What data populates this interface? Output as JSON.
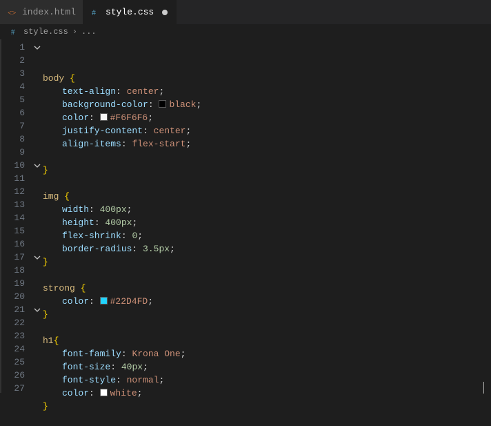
{
  "tabs": [
    {
      "label": "index.html",
      "icon_color": "#e37933",
      "active": false
    },
    {
      "label": "style.css",
      "icon_color": "#519aba",
      "active": true,
      "dirty": true
    }
  ],
  "breadcrumb": {
    "file_icon_color": "#519aba",
    "file": "style.css",
    "rest": "..."
  },
  "lines": [
    {
      "n": "1",
      "fold": true,
      "indent": 0,
      "tokens": [
        [
          "sel",
          "body"
        ],
        [
          "punc",
          " "
        ],
        [
          "brace",
          "{"
        ]
      ]
    },
    {
      "n": "2",
      "fold": false,
      "indent": 1,
      "tokens": [
        [
          "prop",
          "text-align"
        ],
        [
          "punc",
          ": "
        ],
        [
          "val",
          "center"
        ],
        [
          "punc",
          ";"
        ]
      ]
    },
    {
      "n": "3",
      "fold": false,
      "indent": 1,
      "tokens": [
        [
          "prop",
          "background-color"
        ],
        [
          "punc",
          ": "
        ],
        [
          "swatch",
          "#000000"
        ],
        [
          "val",
          "black"
        ],
        [
          "punc",
          ";"
        ]
      ]
    },
    {
      "n": "4",
      "fold": false,
      "indent": 1,
      "tokens": [
        [
          "prop",
          "color"
        ],
        [
          "punc",
          ": "
        ],
        [
          "swatch",
          "#F6F6F6"
        ],
        [
          "val",
          "#F6F6F6"
        ],
        [
          "punc",
          ";"
        ]
      ]
    },
    {
      "n": "5",
      "fold": false,
      "indent": 1,
      "tokens": [
        [
          "prop",
          "justify-content"
        ],
        [
          "punc",
          ": "
        ],
        [
          "val",
          "center"
        ],
        [
          "punc",
          ";"
        ]
      ]
    },
    {
      "n": "6",
      "fold": false,
      "indent": 1,
      "tokens": [
        [
          "prop",
          "align-items"
        ],
        [
          "punc",
          ": "
        ],
        [
          "val",
          "flex-start"
        ],
        [
          "punc",
          ";"
        ]
      ]
    },
    {
      "n": "7",
      "fold": false,
      "indent": 0,
      "tokens": []
    },
    {
      "n": "8",
      "fold": false,
      "indent": 0,
      "tokens": [
        [
          "brace",
          "}"
        ]
      ]
    },
    {
      "n": "9",
      "fold": false,
      "indent": 0,
      "tokens": []
    },
    {
      "n": "10",
      "fold": true,
      "indent": 0,
      "tokens": [
        [
          "sel",
          "img"
        ],
        [
          "punc",
          " "
        ],
        [
          "brace",
          "{"
        ]
      ]
    },
    {
      "n": "11",
      "fold": false,
      "indent": 1,
      "tokens": [
        [
          "prop",
          "width"
        ],
        [
          "punc",
          ": "
        ],
        [
          "num",
          "400"
        ],
        [
          "unit",
          "px"
        ],
        [
          "punc",
          ";"
        ]
      ]
    },
    {
      "n": "12",
      "fold": false,
      "indent": 1,
      "tokens": [
        [
          "prop",
          "height"
        ],
        [
          "punc",
          ": "
        ],
        [
          "num",
          "400"
        ],
        [
          "unit",
          "px"
        ],
        [
          "punc",
          ";"
        ]
      ]
    },
    {
      "n": "13",
      "fold": false,
      "indent": 1,
      "tokens": [
        [
          "prop",
          "flex-shrink"
        ],
        [
          "punc",
          ": "
        ],
        [
          "num",
          "0"
        ],
        [
          "punc",
          ";"
        ]
      ]
    },
    {
      "n": "14",
      "fold": false,
      "indent": 1,
      "tokens": [
        [
          "prop",
          "border-radius"
        ],
        [
          "punc",
          ": "
        ],
        [
          "num",
          "3.5"
        ],
        [
          "unit",
          "px"
        ],
        [
          "punc",
          ";"
        ]
      ]
    },
    {
      "n": "15",
      "fold": false,
      "indent": 0,
      "tokens": [
        [
          "brace",
          "}"
        ]
      ]
    },
    {
      "n": "16",
      "fold": false,
      "indent": 0,
      "tokens": []
    },
    {
      "n": "17",
      "fold": true,
      "indent": 0,
      "tokens": [
        [
          "sel",
          "strong"
        ],
        [
          "punc",
          " "
        ],
        [
          "brace",
          "{"
        ]
      ]
    },
    {
      "n": "18",
      "fold": false,
      "indent": 1,
      "tokens": [
        [
          "prop",
          "color"
        ],
        [
          "punc",
          ": "
        ],
        [
          "swatch",
          "#22D4FD"
        ],
        [
          "val",
          "#22D4FD"
        ],
        [
          "punc",
          ";"
        ]
      ]
    },
    {
      "n": "19",
      "fold": false,
      "indent": 0,
      "tokens": [
        [
          "brace",
          "}"
        ]
      ]
    },
    {
      "n": "20",
      "fold": false,
      "indent": 0,
      "tokens": []
    },
    {
      "n": "21",
      "fold": true,
      "indent": 0,
      "tokens": [
        [
          "sel",
          "h1"
        ],
        [
          "brace",
          "{"
        ]
      ]
    },
    {
      "n": "22",
      "fold": false,
      "indent": 1,
      "tokens": [
        [
          "prop",
          "font-family"
        ],
        [
          "punc",
          ": "
        ],
        [
          "val",
          "Krona One"
        ],
        [
          "punc",
          ";"
        ]
      ]
    },
    {
      "n": "23",
      "fold": false,
      "indent": 1,
      "tokens": [
        [
          "prop",
          "font-size"
        ],
        [
          "punc",
          ": "
        ],
        [
          "num",
          "40"
        ],
        [
          "unit",
          "px"
        ],
        [
          "punc",
          ";"
        ]
      ]
    },
    {
      "n": "24",
      "fold": false,
      "indent": 1,
      "tokens": [
        [
          "prop",
          "font-style"
        ],
        [
          "punc",
          ": "
        ],
        [
          "val",
          "normal"
        ],
        [
          "punc",
          ";"
        ]
      ]
    },
    {
      "n": "25",
      "fold": false,
      "indent": 1,
      "tokens": [
        [
          "prop",
          "color"
        ],
        [
          "punc",
          ": "
        ],
        [
          "swatch",
          "#ffffff"
        ],
        [
          "val",
          "white"
        ],
        [
          "punc",
          ";"
        ]
      ]
    },
    {
      "n": "26",
      "fold": false,
      "indent": 0,
      "tokens": [
        [
          "brace",
          "}"
        ]
      ]
    },
    {
      "n": "27",
      "fold": false,
      "indent": 0,
      "tokens": []
    }
  ]
}
